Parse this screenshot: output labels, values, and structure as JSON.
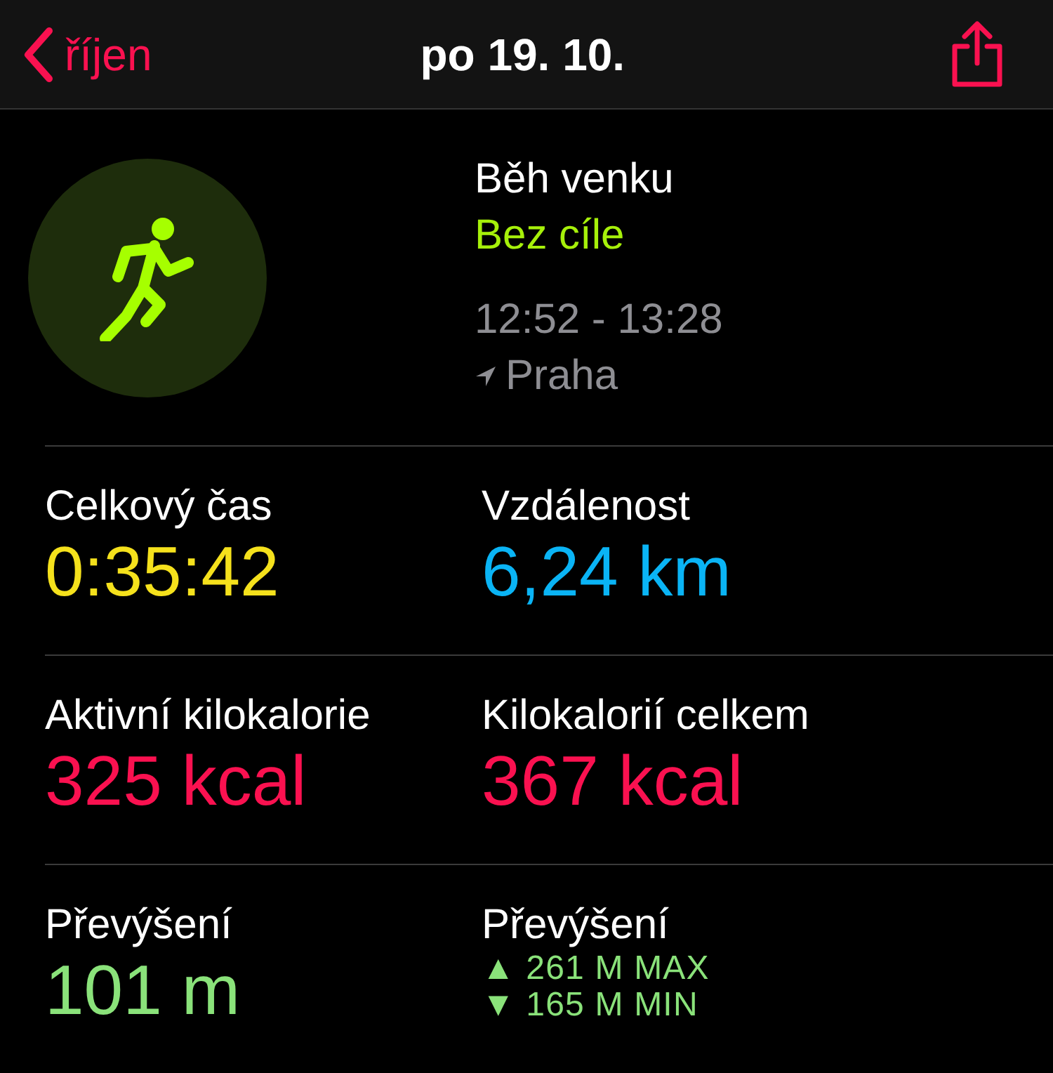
{
  "header": {
    "back_label": "říjen",
    "title": "po 19. 10."
  },
  "workout": {
    "name": "Běh venku",
    "goal": "Bez cíle",
    "time_range": "12:52 - 13:28",
    "location": "Praha"
  },
  "metrics": [
    {
      "kind": "value",
      "label": "Celkový čas",
      "value": "0:35:42",
      "color": "#f5e11c"
    },
    {
      "kind": "value",
      "label": "Vzdálenost",
      "value": "6,24 km",
      "color": "#0ab4f5"
    },
    {
      "kind": "value",
      "label": "Aktivní kilokalorie",
      "value": "325 kcal",
      "color": "#fa1150"
    },
    {
      "kind": "value",
      "label": "Kilokalorií celkem",
      "value": "367 kcal",
      "color": "#fa1150"
    },
    {
      "kind": "value",
      "label": "Převýšení",
      "value": "101 m",
      "color": "#8ae27a"
    },
    {
      "kind": "range",
      "label": "Převýšení",
      "lines": [
        "▲ 261 M MAX",
        "▼ 165 M MIN"
      ],
      "color": "#8ae27a"
    }
  ]
}
